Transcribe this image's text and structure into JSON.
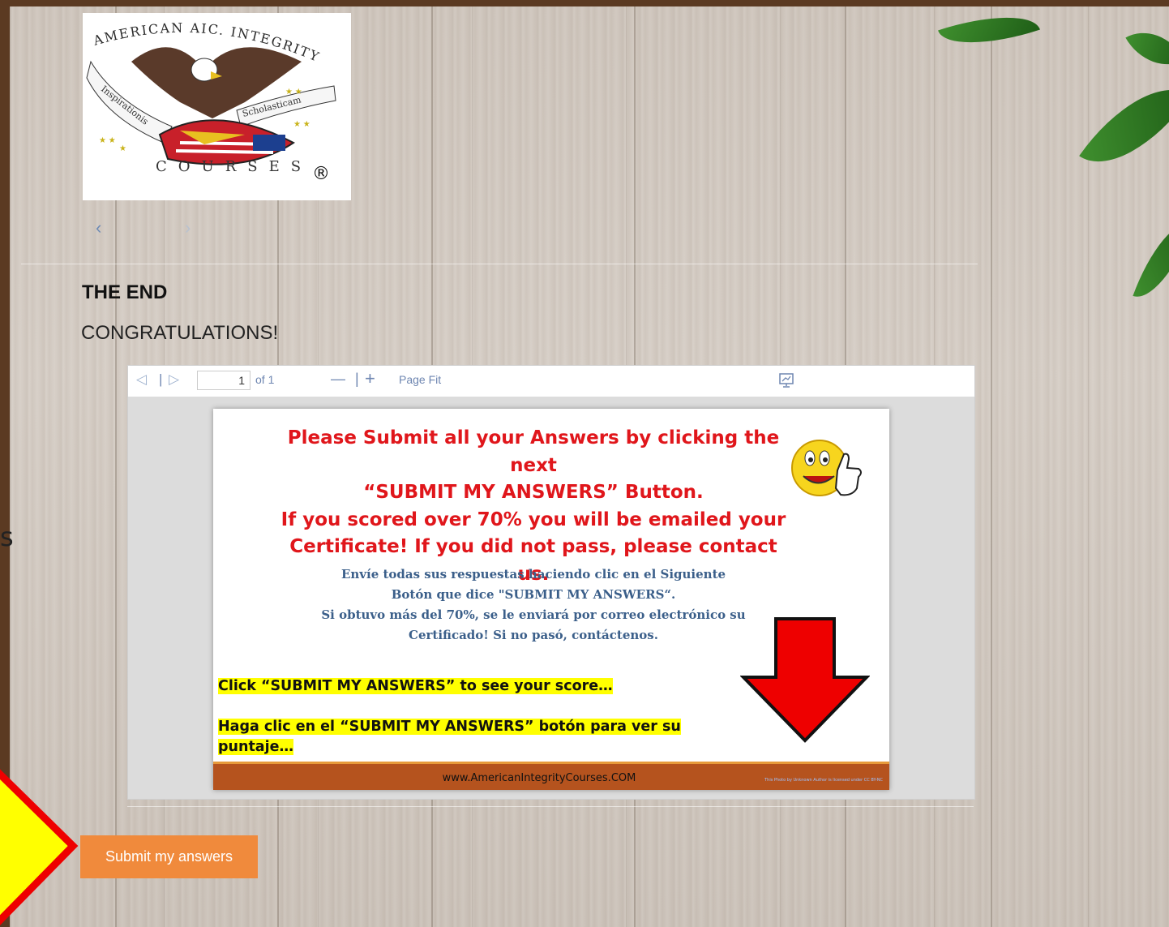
{
  "logo": {
    "arc_text": "AMERICAN AIC. INTEGRITY",
    "ribbon_left": "Inspirationis",
    "ribbon_right": "Scholasticam",
    "bottom_text": "COURSES",
    "registered": "®"
  },
  "carousel": {
    "prev_icon": "‹",
    "next_icon": "›"
  },
  "content": {
    "heading": "THE END",
    "subheading": "CONGRATULATIONS!"
  },
  "stray_text": "s",
  "viewer": {
    "toolbar": {
      "prev_icon": "◁",
      "separator": "|",
      "next_icon": "▷",
      "page_value": "1",
      "page_total": "of 1",
      "zoom_out": "—",
      "zoom_sep": "|",
      "zoom_in": "+",
      "page_fit": "Page Fit"
    },
    "slide": {
      "red_lines": [
        "Please Submit all your Answers by clicking the next",
        "“SUBMIT MY ANSWERS” Button.",
        "If you scored over 70% you will be emailed your",
        "Certificate! If you did not pass, please contact us."
      ],
      "blue_lines": [
        "Envíe todas sus respuestas haciendo clic en el Siguiente",
        "Botón que dice \"SUBMIT MY ANSWERS“.",
        "Si obtuvo más del 70%, se le enviará por correo electrónico su",
        "Certificado! Si no pasó, contáctenos."
      ],
      "highlight_1": "Click “SUBMIT MY ANSWERS” to see your score…",
      "highlight_2a": "Haga clic en el “SUBMIT MY ANSWERS” botón para ver su",
      "highlight_2b": "puntaje…",
      "footer_url": "www.AmericanIntegrityCourses.COM",
      "footer_credit": "This Photo by Unknown Author is licensed under CC BY-NC"
    }
  },
  "submit_button": {
    "label": "Submit my answers"
  },
  "colors": {
    "accent_orange": "#f08a3c",
    "slide_red": "#e0161b",
    "slide_blue": "#3b5f8a",
    "highlight_yellow": "#ffff00",
    "footer_brown": "#b5531e"
  }
}
